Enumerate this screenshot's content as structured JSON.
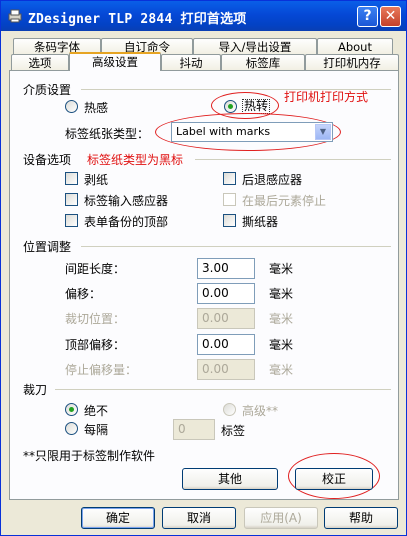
{
  "window": {
    "title": "ZDesigner TLP 2844 打印首选项",
    "help": "?",
    "close": "✕"
  },
  "tabs_back": [
    "条码字体",
    "自订命令",
    "导入/导出设置",
    "About"
  ],
  "tabs_front": [
    "选项",
    "高级设置",
    "抖动",
    "标签库",
    "打印机内存"
  ],
  "media": {
    "group": "介质设置",
    "thermal": "热感",
    "thermal_transfer": "热转",
    "label_type_label": "标签纸张类型：",
    "label_type_value": "Label with marks",
    "annotation_print_mode": "打印机打印方式"
  },
  "device": {
    "group": "设备选项",
    "annotation_label_type": "标签纸类型为黑标",
    "peel": "剥纸",
    "backfeed_sensor": "后退感应器",
    "label_taken_sensor": "标签输入感应器",
    "stop_last": "在最后元素停止",
    "backup_top": "表单备份的顶部",
    "tear": "撕纸器"
  },
  "position": {
    "group": "位置调整",
    "gap_label": "间距长度：",
    "gap_value": "3.00",
    "offset_label": "偏移：",
    "offset_value": "0.00",
    "cut_label": "裁切位置：",
    "cut_value": "0.00",
    "top_label": "顶部偏移：",
    "top_value": "0.00",
    "stop_label": "停止偏移量：",
    "stop_value": "0.00",
    "unit": "毫米"
  },
  "cutter": {
    "group": "裁刀",
    "never": "绝不",
    "every": "每隔",
    "advanced": "高级**",
    "count": "0",
    "count_unit": "标签"
  },
  "footnote": "**只限用于标签制作软件",
  "buttons": {
    "other": "其他",
    "calibrate": "校正",
    "ok": "确定",
    "cancel": "取消",
    "apply": "应用(A)",
    "help": "帮助"
  }
}
